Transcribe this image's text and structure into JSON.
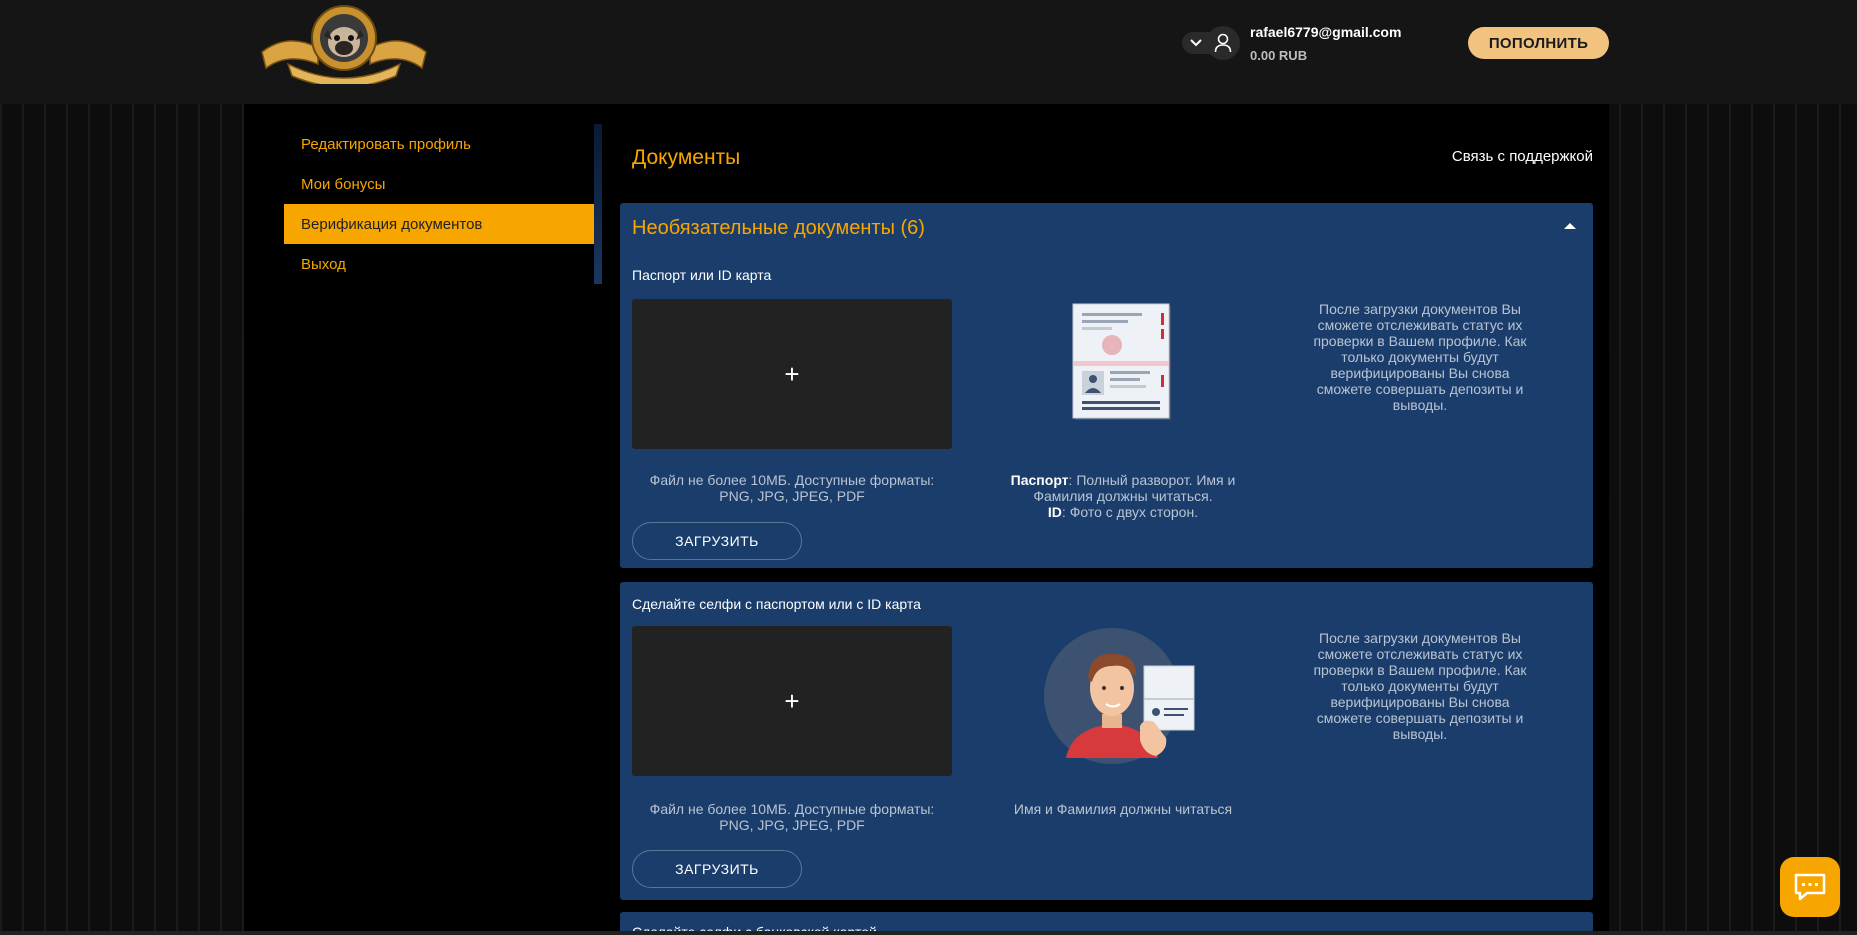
{
  "header": {
    "user_email": "rafael6779@gmail.com",
    "user_balance": "0.00 RUB",
    "topup_label": "ПОПОЛНИТЬ"
  },
  "sidebar": {
    "items": [
      {
        "label": "Редактировать профиль",
        "active": false
      },
      {
        "label": "Мои бонусы",
        "active": false
      },
      {
        "label": "Верификация документов",
        "active": true
      },
      {
        "label": "Выход",
        "active": false
      }
    ]
  },
  "main": {
    "title": "Документы",
    "support_link": "Связь с поддержкой",
    "section_title": "Необязательные документы (6)",
    "side_note": "После загрузки документов Вы сможете отслеживать статус их проверки в Вашем профиле. Как только документы будут верифицированы Вы снова сможете совершать депозиты и выводы.",
    "documents": [
      {
        "title": "Паспорт или ID карта",
        "upload_plus": "+",
        "hint": "Файл не более 10МБ. Доступные форматы: PNG, JPG, JPEG, PDF",
        "upload_label": "ЗАГРУЗИТЬ",
        "caption_bold_1": "Паспорт",
        "caption_text_1": ": Полный разворот. Имя и Фамилия должны читаться.",
        "caption_bold_2": "ID",
        "caption_text_2": ": Фото с двух сторон."
      },
      {
        "title": "Сделайте селфи с паспортом или с ID карта",
        "upload_plus": "+",
        "hint": "Файл не более 10МБ. Доступные форматы: PNG, JPG, JPEG, PDF",
        "upload_label": "ЗАГРУЗИТЬ",
        "caption": "Имя и Фамилия должны читаться"
      },
      {
        "title": "Сделайте селфи с банковской картой"
      }
    ]
  },
  "colors": {
    "accent": "#f7a600",
    "card_bg": "#1a3d6b",
    "topup_bg": "#f2c37f"
  },
  "icons": [
    "logo-pug-emblem",
    "chevron-down-icon",
    "user-icon",
    "caret-up-icon",
    "passport-illustration",
    "selfie-illustration",
    "chat-icon"
  ]
}
